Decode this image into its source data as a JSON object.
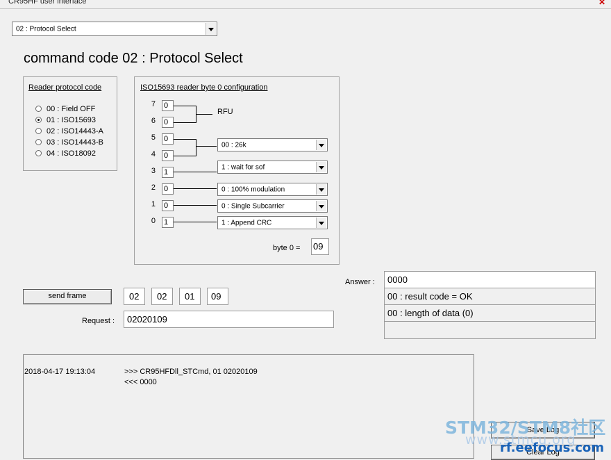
{
  "window": {
    "title": "CR95HF user interface",
    "close_glyph": "✕"
  },
  "command_select": {
    "value": "02 : Protocol Select"
  },
  "heading": "command code 02 : Protocol Select",
  "reader_protocol": {
    "title": "Reader protocol code",
    "options": [
      "00 : Field OFF",
      "01 : ISO15693",
      "02 : ISO14443-A",
      "03 : ISO14443-B",
      "04 : ISO18092"
    ],
    "selected_index": 1
  },
  "iso_config": {
    "title": "ISO15693 reader byte 0 configuration",
    "bits": [
      {
        "num": "7",
        "value": "0"
      },
      {
        "num": "6",
        "value": "0"
      },
      {
        "num": "5",
        "value": "0"
      },
      {
        "num": "4",
        "value": "0"
      },
      {
        "num": "3",
        "value": "1"
      },
      {
        "num": "2",
        "value": "0"
      },
      {
        "num": "1",
        "value": "0"
      },
      {
        "num": "0",
        "value": "1"
      }
    ],
    "rfu_label": "RFU",
    "dropdowns": [
      "00 : 26k",
      "1 : wait for sof",
      "0 : 100% modulation",
      "0 : Single Subcarrier",
      "1 : Append CRC"
    ],
    "byte0_label": "byte 0 =",
    "byte0_value": "09"
  },
  "send": {
    "button_label": "send frame",
    "bytes": [
      "02",
      "02",
      "01",
      "09"
    ],
    "request_label": "Request :",
    "request_value": "02020109"
  },
  "answer": {
    "label": "Answer :",
    "lines": [
      "0000",
      "00 : result code = OK",
      "00 : length of data (0)",
      ""
    ]
  },
  "log": {
    "timestamp": "2018-04-17 19:13:04",
    "line1": ">>> CR95HFDll_STCmd, 01 02020109",
    "line2": "<<< 0000"
  },
  "buttons": {
    "save_log": "Save Log",
    "clear_log": "Clear Log"
  },
  "watermark": {
    "line1": "STM32/STM8社区",
    "line2": "www.stmcu.org",
    "line3": "rf.eefocus.com"
  }
}
